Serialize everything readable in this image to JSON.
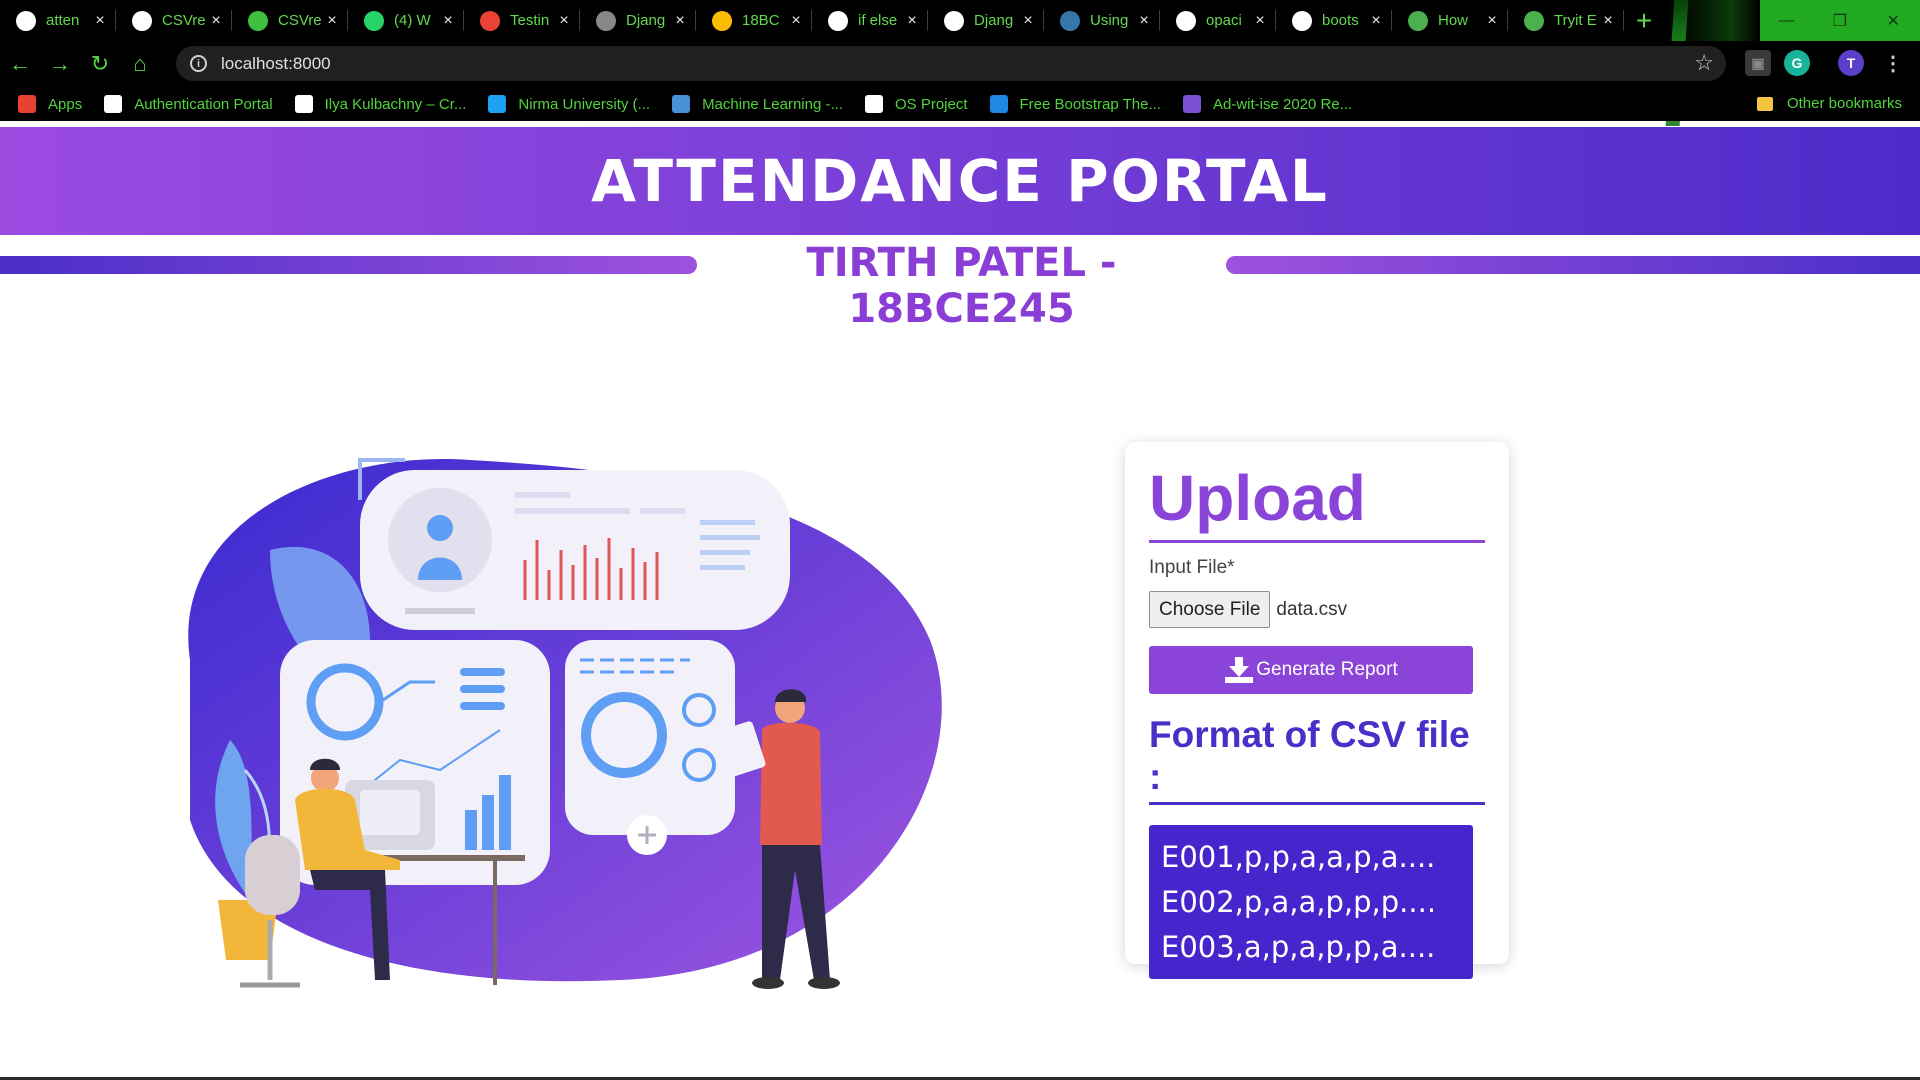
{
  "browser": {
    "tabs": [
      {
        "title": "atten",
        "icon": "github-icon",
        "color": "#ffffff"
      },
      {
        "title": "CSVre",
        "icon": "github-icon",
        "color": "#ffffff"
      },
      {
        "title": "CSVre",
        "icon": "globe-icon",
        "color": "#3fbf3f"
      },
      {
        "title": "(4) W",
        "icon": "whatsapp-icon",
        "color": "#25d366"
      },
      {
        "title": "Testin",
        "icon": "gmail-icon",
        "color": "#ea4335"
      },
      {
        "title": "Djang",
        "icon": "globe-icon",
        "color": "#888888"
      },
      {
        "title": "18BC",
        "icon": "drive-icon",
        "color": "#fbbc04"
      },
      {
        "title": "if else",
        "icon": "google-icon",
        "color": "#ffffff"
      },
      {
        "title": "Djang",
        "icon": "dj-icon",
        "color": "#ffffff"
      },
      {
        "title": "Using",
        "icon": "python-icon",
        "color": "#3776ab"
      },
      {
        "title": "opaci",
        "icon": "google-icon",
        "color": "#ffffff"
      },
      {
        "title": "boots",
        "icon": "google-icon",
        "color": "#ffffff"
      },
      {
        "title": "How",
        "icon": "w3-icon",
        "color": "#4caf50"
      },
      {
        "title": "Tryit E",
        "icon": "w3-icon",
        "color": "#4caf50"
      }
    ],
    "new_tab": "+",
    "url": "localhost:8000",
    "profile_initial": "T",
    "bookmarks": [
      {
        "label": "Apps",
        "icon": "apps-grid-icon",
        "color": "#e94235"
      },
      {
        "label": "Authentication Portal",
        "icon": "gear-icon",
        "color": "#ffffff"
      },
      {
        "label": "Ilya Kulbachny – Cr...",
        "icon": "ik-icon",
        "color": "#ffffff"
      },
      {
        "label": "Nirma University (...",
        "icon": "twitter-icon",
        "color": "#1da1f2"
      },
      {
        "label": "Machine Learning -...",
        "icon": "infinity-icon",
        "color": "#4a90d9"
      },
      {
        "label": "OS Project",
        "icon": "github-icon",
        "color": "#ffffff"
      },
      {
        "label": "Free Bootstrap The...",
        "icon": "bootstrap-icon",
        "color": "#1e88e5"
      },
      {
        "label": "Ad-wit-ise 2020 Re...",
        "icon": "form-icon",
        "color": "#7b4fd4"
      }
    ],
    "other_bookmarks": "Other bookmarks"
  },
  "page": {
    "title": "ATTENDANCE PORTAL",
    "subtitle": "TIRTH PATEL - 18BCE245",
    "upload": {
      "heading": "Upload",
      "input_label": "Input File*",
      "choose_file": "Choose File",
      "file_name": "data.csv",
      "generate_button": "Generate Report",
      "format_heading": "Format of CSV file :",
      "csv_lines": [
        "E001,p,p,a,a,p,a....",
        "E002,p,a,a,p,p,p....",
        "E003,a,p,a,p,p,a...."
      ]
    },
    "colors": {
      "primary": "#8a44d8",
      "secondary": "#4a2ec8",
      "browser_accent": "#52d33d"
    }
  }
}
